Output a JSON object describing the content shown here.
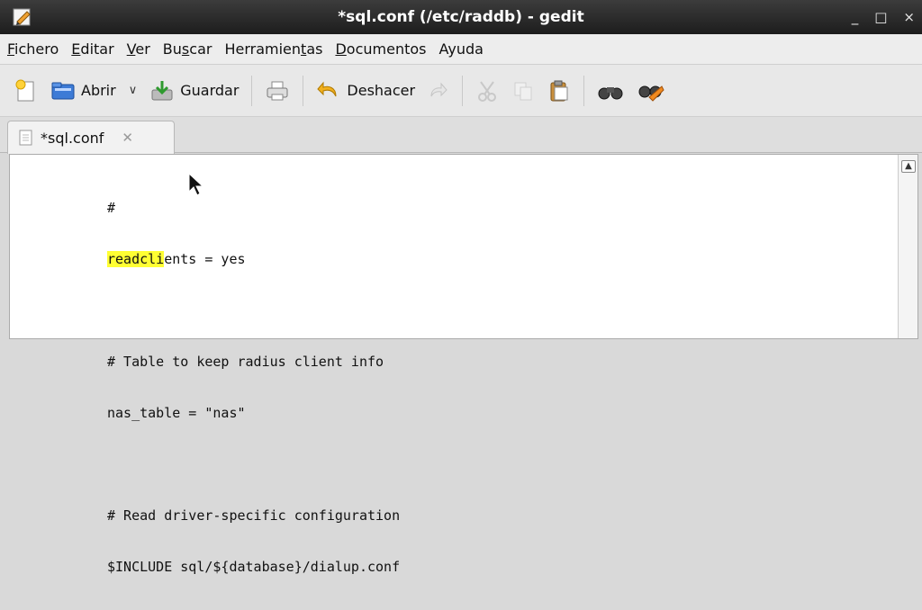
{
  "window": {
    "title": "*sql.conf (/etc/raddb) - gedit",
    "minimize_glyph": "_",
    "maximize_glyph": "□",
    "close_glyph": "×"
  },
  "menu": {
    "items": [
      {
        "mnemonic": "F",
        "rest": "ichero"
      },
      {
        "mnemonic": "E",
        "rest": "ditar"
      },
      {
        "mnemonic": "V",
        "rest": "er"
      },
      {
        "pre": "Bu",
        "mnemonic": "s",
        "rest": "car"
      },
      {
        "pre": "Herramien",
        "mnemonic": "t",
        "rest": "as"
      },
      {
        "mnemonic": "D",
        "rest": "ocumentos"
      },
      {
        "pre": "Ayuda",
        "mnemonic": "",
        "rest": ""
      }
    ]
  },
  "toolbar": {
    "open_label": "Abrir",
    "save_label": "Guardar",
    "undo_label": "Deshacer"
  },
  "tab": {
    "label": "*sql.conf",
    "close_glyph": "✕"
  },
  "editor": {
    "line1": "#",
    "line2_highlight": "readcli",
    "line2_rest": "ents = yes",
    "line3": "",
    "line4": "# Table to keep radius client info",
    "line5": "nas_table = \"nas\"",
    "line6": "",
    "line7": "# Read driver-specific configuration",
    "line8": "$INCLUDE sql/${database}/dialup.conf"
  },
  "colors": {
    "titlebar": "#2a2a2a",
    "highlight": "#ffff33"
  }
}
